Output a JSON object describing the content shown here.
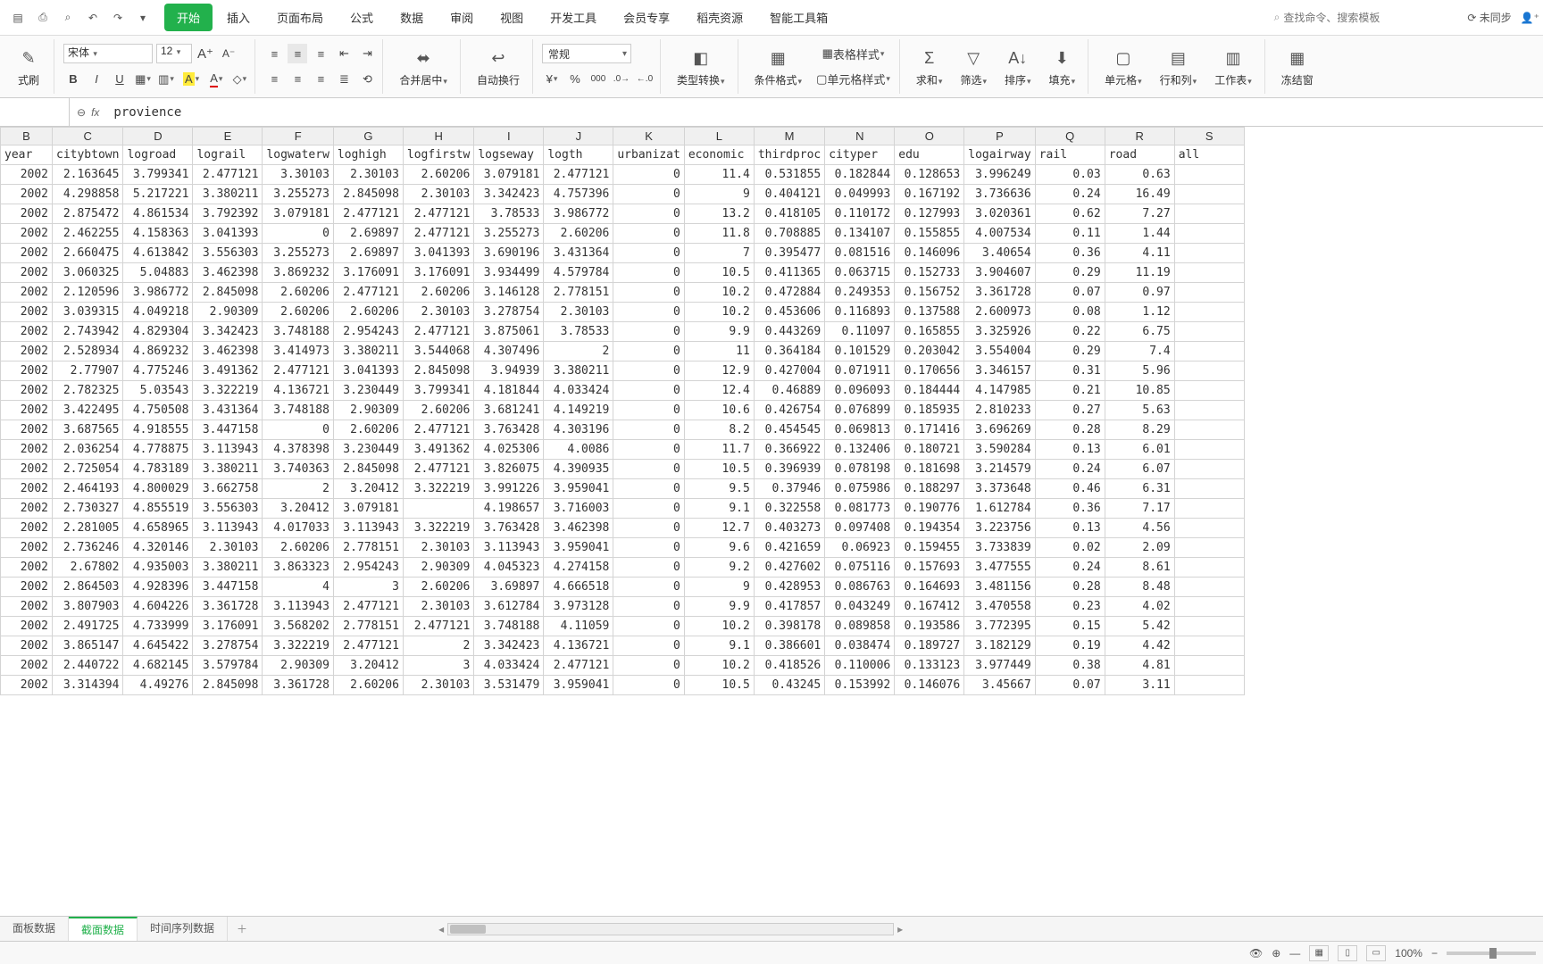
{
  "menu_tabs": [
    "开始",
    "插入",
    "页面布局",
    "公式",
    "数据",
    "审阅",
    "视图",
    "开发工具",
    "会员专享",
    "稻壳资源",
    "智能工具箱"
  ],
  "active_menu_tab": 0,
  "search_placeholder": "查找命令、搜索模板",
  "sync_status": "未同步",
  "ribbon": {
    "format_painter": "式刷",
    "font_name": "宋体",
    "font_size": "12",
    "merge_center": "合并居中",
    "wrap_text": "自动换行",
    "number_format": "常规",
    "type_convert": "类型转换",
    "cond_format": "条件格式",
    "table_style": "表格样式",
    "cell_style": "单元格样式",
    "sum": "求和",
    "filter": "筛选",
    "sort": "排序",
    "fill": "填充",
    "cell": "单元格",
    "rowcol": "行和列",
    "sheet": "工作表",
    "freeze": "冻结窗"
  },
  "formula_bar": {
    "name_box": "",
    "formula": "provience"
  },
  "columns": [
    "B",
    "C",
    "D",
    "E",
    "F",
    "G",
    "H",
    "I",
    "J",
    "K",
    "L",
    "M",
    "N",
    "O",
    "P",
    "Q",
    "R",
    "S"
  ],
  "headers": [
    "year",
    "citybtown",
    "logroad",
    "lograil",
    "logwaterw",
    "loghigh",
    "logfirstw",
    "logseway",
    "logth",
    "urbanizat",
    "economic",
    "thirdproc",
    "cityper",
    "edu",
    "logairway",
    "rail",
    "road",
    "all"
  ],
  "rows": [
    [
      "2002",
      "2.163645",
      "3.799341",
      "2.477121",
      "3.30103",
      "2.30103",
      "2.60206",
      "3.079181",
      "2.477121",
      "0",
      "11.4",
      "0.531855",
      "0.182844",
      "0.128653",
      "3.996249",
      "0.03",
      "0.63",
      ""
    ],
    [
      "2002",
      "4.298858",
      "5.217221",
      "3.380211",
      "3.255273",
      "2.845098",
      "2.30103",
      "3.342423",
      "4.757396",
      "0",
      "9",
      "0.404121",
      "0.049993",
      "0.167192",
      "3.736636",
      "0.24",
      "16.49",
      ""
    ],
    [
      "2002",
      "2.875472",
      "4.861534",
      "3.792392",
      "3.079181",
      "2.477121",
      "2.477121",
      "3.78533",
      "3.986772",
      "0",
      "13.2",
      "0.418105",
      "0.110172",
      "0.127993",
      "3.020361",
      "0.62",
      "7.27",
      ""
    ],
    [
      "2002",
      "2.462255",
      "4.158363",
      "3.041393",
      "0",
      "2.69897",
      "2.477121",
      "3.255273",
      "2.60206",
      "0",
      "11.8",
      "0.708885",
      "0.134107",
      "0.155855",
      "4.007534",
      "0.11",
      "1.44",
      ""
    ],
    [
      "2002",
      "2.660475",
      "4.613842",
      "3.556303",
      "3.255273",
      "2.69897",
      "3.041393",
      "3.690196",
      "3.431364",
      "0",
      "7",
      "0.395477",
      "0.081516",
      "0.146096",
      "3.40654",
      "0.36",
      "4.11",
      ""
    ],
    [
      "2002",
      "3.060325",
      "5.04883",
      "3.462398",
      "3.869232",
      "3.176091",
      "3.176091",
      "3.934499",
      "4.579784",
      "0",
      "10.5",
      "0.411365",
      "0.063715",
      "0.152733",
      "3.904607",
      "0.29",
      "11.19",
      ""
    ],
    [
      "2002",
      "2.120596",
      "3.986772",
      "2.845098",
      "2.60206",
      "2.477121",
      "2.60206",
      "3.146128",
      "2.778151",
      "0",
      "10.2",
      "0.472884",
      "0.249353",
      "0.156752",
      "3.361728",
      "0.07",
      "0.97",
      ""
    ],
    [
      "2002",
      "3.039315",
      "4.049218",
      "2.90309",
      "2.60206",
      "2.60206",
      "2.30103",
      "3.278754",
      "2.30103",
      "0",
      "10.2",
      "0.453606",
      "0.116893",
      "0.137588",
      "2.600973",
      "0.08",
      "1.12",
      ""
    ],
    [
      "2002",
      "2.743942",
      "4.829304",
      "3.342423",
      "3.748188",
      "2.954243",
      "2.477121",
      "3.875061",
      "3.78533",
      "0",
      "9.9",
      "0.443269",
      "0.11097",
      "0.165855",
      "3.325926",
      "0.22",
      "6.75",
      ""
    ],
    [
      "2002",
      "2.528934",
      "4.869232",
      "3.462398",
      "3.414973",
      "3.380211",
      "3.544068",
      "4.307496",
      "2",
      "0",
      "11",
      "0.364184",
      "0.101529",
      "0.203042",
      "3.554004",
      "0.29",
      "7.4",
      ""
    ],
    [
      "2002",
      "2.77907",
      "4.775246",
      "3.491362",
      "2.477121",
      "3.041393",
      "2.845098",
      "3.94939",
      "3.380211",
      "0",
      "12.9",
      "0.427004",
      "0.071911",
      "0.170656",
      "3.346157",
      "0.31",
      "5.96",
      ""
    ],
    [
      "2002",
      "2.782325",
      "5.03543",
      "3.322219",
      "4.136721",
      "3.230449",
      "3.799341",
      "4.181844",
      "4.033424",
      "0",
      "12.4",
      "0.46889",
      "0.096093",
      "0.184444",
      "4.147985",
      "0.21",
      "10.85",
      ""
    ],
    [
      "2002",
      "3.422495",
      "4.750508",
      "3.431364",
      "3.748188",
      "2.90309",
      "2.60206",
      "3.681241",
      "4.149219",
      "0",
      "10.6",
      "0.426754",
      "0.076899",
      "0.185935",
      "2.810233",
      "0.27",
      "5.63",
      ""
    ],
    [
      "2002",
      "3.687565",
      "4.918555",
      "3.447158",
      "0",
      "2.60206",
      "2.477121",
      "3.763428",
      "4.303196",
      "0",
      "8.2",
      "0.454545",
      "0.069813",
      "0.171416",
      "3.696269",
      "0.28",
      "8.29",
      ""
    ],
    [
      "2002",
      "2.036254",
      "4.778875",
      "3.113943",
      "4.378398",
      "3.230449",
      "3.491362",
      "4.025306",
      "4.0086",
      "0",
      "11.7",
      "0.366922",
      "0.132406",
      "0.180721",
      "3.590284",
      "0.13",
      "6.01",
      ""
    ],
    [
      "2002",
      "2.725054",
      "4.783189",
      "3.380211",
      "3.740363",
      "2.845098",
      "2.477121",
      "3.826075",
      "4.390935",
      "0",
      "10.5",
      "0.396939",
      "0.078198",
      "0.181698",
      "3.214579",
      "0.24",
      "6.07",
      ""
    ],
    [
      "2002",
      "2.464193",
      "4.800029",
      "3.662758",
      "2",
      "3.20412",
      "3.322219",
      "3.991226",
      "3.959041",
      "0",
      "9.5",
      "0.37946",
      "0.075986",
      "0.188297",
      "3.373648",
      "0.46",
      "6.31",
      ""
    ],
    [
      "2002",
      "2.730327",
      "4.855519",
      "3.556303",
      "3.20412",
      "3.079181",
      "",
      "4.198657",
      "3.716003",
      "0",
      "9.1",
      "0.322558",
      "0.081773",
      "0.190776",
      "1.612784",
      "0.36",
      "7.17",
      ""
    ],
    [
      "2002",
      "2.281005",
      "4.658965",
      "3.113943",
      "4.017033",
      "3.113943",
      "3.322219",
      "3.763428",
      "3.462398",
      "0",
      "12.7",
      "0.403273",
      "0.097408",
      "0.194354",
      "3.223756",
      "0.13",
      "4.56",
      ""
    ],
    [
      "2002",
      "2.736246",
      "4.320146",
      "2.30103",
      "2.60206",
      "2.778151",
      "2.30103",
      "3.113943",
      "3.959041",
      "0",
      "9.6",
      "0.421659",
      "0.06923",
      "0.159455",
      "3.733839",
      "0.02",
      "2.09",
      ""
    ],
    [
      "2002",
      "2.67802",
      "4.935003",
      "3.380211",
      "3.863323",
      "2.954243",
      "2.90309",
      "4.045323",
      "4.274158",
      "0",
      "9.2",
      "0.427602",
      "0.075116",
      "0.157693",
      "3.477555",
      "0.24",
      "8.61",
      ""
    ],
    [
      "2002",
      "2.864503",
      "4.928396",
      "3.447158",
      "4",
      "3",
      "2.60206",
      "3.69897",
      "4.666518",
      "0",
      "9",
      "0.428953",
      "0.086763",
      "0.164693",
      "3.481156",
      "0.28",
      "8.48",
      ""
    ],
    [
      "2002",
      "3.807903",
      "4.604226",
      "3.361728",
      "3.113943",
      "2.477121",
      "2.30103",
      "3.612784",
      "3.973128",
      "0",
      "9.9",
      "0.417857",
      "0.043249",
      "0.167412",
      "3.470558",
      "0.23",
      "4.02",
      ""
    ],
    [
      "2002",
      "2.491725",
      "4.733999",
      "3.176091",
      "3.568202",
      "2.778151",
      "2.477121",
      "3.748188",
      "4.11059",
      "0",
      "10.2",
      "0.398178",
      "0.089858",
      "0.193586",
      "3.772395",
      "0.15",
      "5.42",
      ""
    ],
    [
      "2002",
      "3.865147",
      "4.645422",
      "3.278754",
      "3.322219",
      "2.477121",
      "2",
      "3.342423",
      "4.136721",
      "0",
      "9.1",
      "0.386601",
      "0.038474",
      "0.189727",
      "3.182129",
      "0.19",
      "4.42",
      ""
    ],
    [
      "2002",
      "2.440722",
      "4.682145",
      "3.579784",
      "2.90309",
      "3.20412",
      "3",
      "4.033424",
      "2.477121",
      "0",
      "10.2",
      "0.418526",
      "0.110006",
      "0.133123",
      "3.977449",
      "0.38",
      "4.81",
      ""
    ],
    [
      "2002",
      "3.314394",
      "4.49276",
      "2.845098",
      "3.361728",
      "2.60206",
      "2.30103",
      "3.531479",
      "3.959041",
      "0",
      "10.5",
      "0.43245",
      "0.153992",
      "0.146076",
      "3.45667",
      "0.07",
      "3.11",
      ""
    ]
  ],
  "sheet_tabs": [
    "面板数据",
    "截面数据",
    "时间序列数据"
  ],
  "active_sheet_tab": 1,
  "zoom": "100%"
}
